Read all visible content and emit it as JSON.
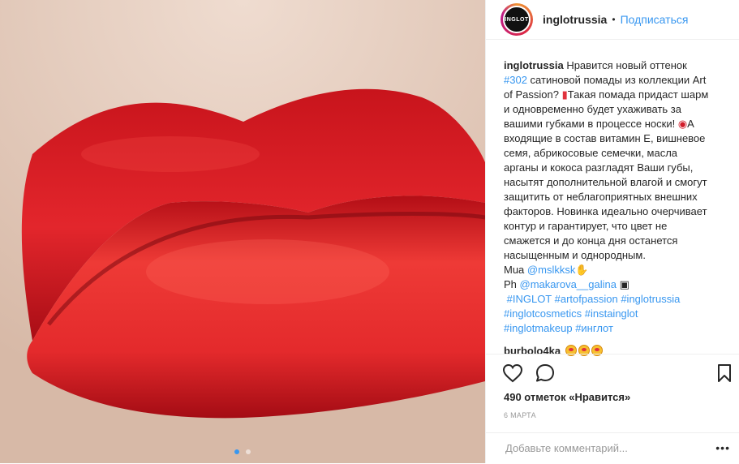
{
  "header": {
    "avatar_text": "INGLOT",
    "username": "inglotrussia",
    "separator": "•",
    "follow_label": "Подписаться"
  },
  "caption": {
    "username": "inglotrussia",
    "text_1": "Нравится новый оттенок",
    "tag_302": "#302",
    "text_2": "сатиновой помады из коллекции Art of Passion?",
    "text_3": "Такая помада придаст шарм и одновременно будет ухаживать за вашими губками в процессе носки!",
    "text_4": "А входящие в состав витамин Е, вишневое семя, абрикосовые семечки, масла арганы и кокоса разгладят Ваши губы, насытят дополнительной влагой и смогут защитить от неблагоприятных внешних факторов. Новинка идеально очерчивает контур и гарантирует, что цвет не смажется и до конца дня останется насыщенным и однородным.",
    "mua_label": "Mua",
    "mua_handle": "@mslkksk",
    "ph_label": "Ph",
    "ph_handle": "@makarova__galina",
    "hashtags": [
      "#INGLOT",
      "#artofpassion",
      "#inglotrussia",
      "#inglotcosmetics",
      "#instainglot",
      "#inglotmakeup",
      "#инглот"
    ]
  },
  "comment": {
    "username": "burbolo4ka"
  },
  "actions": {
    "like_icon": "heart-icon",
    "comment_icon": "comment-icon",
    "save_icon": "bookmark-icon"
  },
  "likes_text": "490 отметок «Нравится»",
  "date_text": "6 МАРТА",
  "add_comment": {
    "placeholder": "Добавьте комментарий...",
    "more": "•••"
  },
  "colors": {
    "link": "#3897f0",
    "lip_red": "#e5202a"
  }
}
